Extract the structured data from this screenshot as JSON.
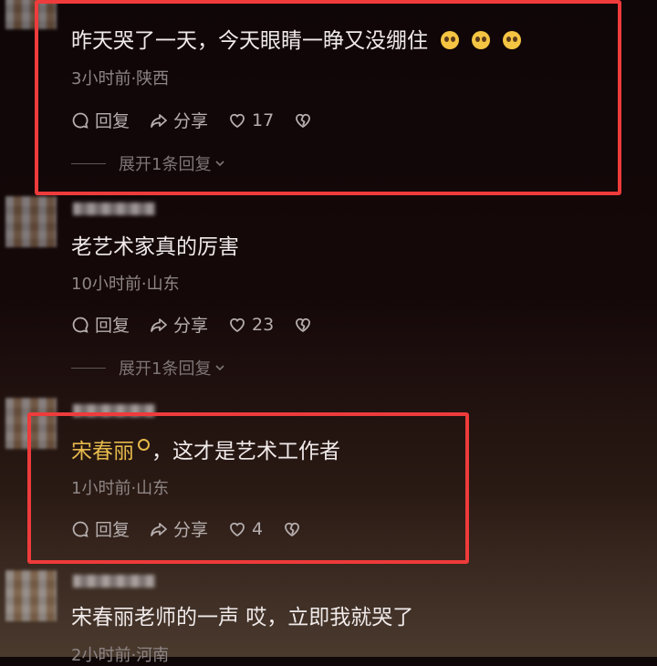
{
  "comments": [
    {
      "text": "昨天哭了一天，今天眼睛一睁又没绷住",
      "meta": "3小时前·陕西",
      "reply_label": "回复",
      "share_label": "分享",
      "likes": "17",
      "expand_label": "展开1条回复"
    },
    {
      "text": "老艺术家真的厉害",
      "meta": "10小时前·山东",
      "reply_label": "回复",
      "share_label": "分享",
      "likes": "23",
      "expand_label": "展开1条回复"
    },
    {
      "mention": "宋春丽",
      "text": "，这才是艺术工作者",
      "meta": "1小时前·山东",
      "reply_label": "回复",
      "share_label": "分享",
      "likes": "4"
    },
    {
      "text": "宋春丽老师的一声 哎，立即我就哭了",
      "meta": "2小时前·河南"
    }
  ],
  "colors": {
    "highlight": "#ee3b3b",
    "mention": "#e5b94b",
    "background": "#150809"
  },
  "icons": [
    "reply-icon",
    "share-icon",
    "heart-icon",
    "dislike-icon",
    "chevron-down-icon",
    "crying-emoji"
  ]
}
